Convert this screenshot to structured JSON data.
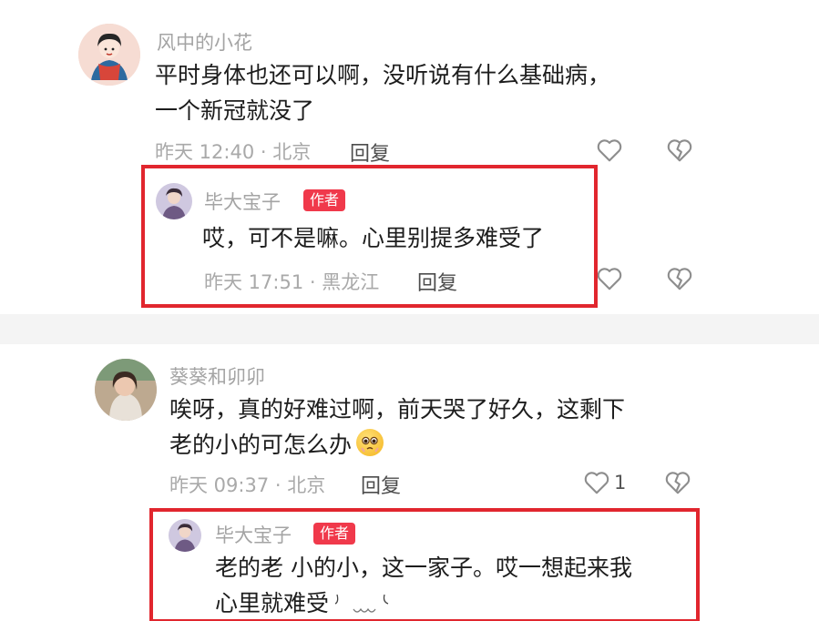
{
  "colors": {
    "highlight": "#e1262e",
    "author_badge": "#f0394b"
  },
  "comments": [
    {
      "username": "风中的小花",
      "text_line1": "平时身体也还可以啊，没听说有什么基础病，",
      "text_line2": "一个新冠就没了",
      "meta": "昨天 12:40 · 北京",
      "reply_label": "回复",
      "like_icon": "heart-outline-icon",
      "dislike_icon": "broken-heart-icon",
      "reply": {
        "username": "毕大宝子",
        "badge": "作者",
        "text": "哎，可不是嘛。心里别提多难受了",
        "meta": "昨天 17:51 · 黑龙江",
        "reply_label": "回复"
      }
    },
    {
      "username": "葵葵和卯卯",
      "text_line1": "唉呀，真的好难过啊，前天哭了好久，这剩下",
      "text_line2": "老的小的可怎么办",
      "emoji": "pleading-face-emoji",
      "meta": "昨天 09:37 · 北京",
      "reply_label": "回复",
      "like_count": "1",
      "reply": {
        "username": "毕大宝子",
        "badge": "作者",
        "text_line1": "老的老 小的小，这一家子。哎一想起来我",
        "text_line2": "心里就难受",
        "trailing_emoji": "sad-tears-emoji"
      }
    }
  ]
}
